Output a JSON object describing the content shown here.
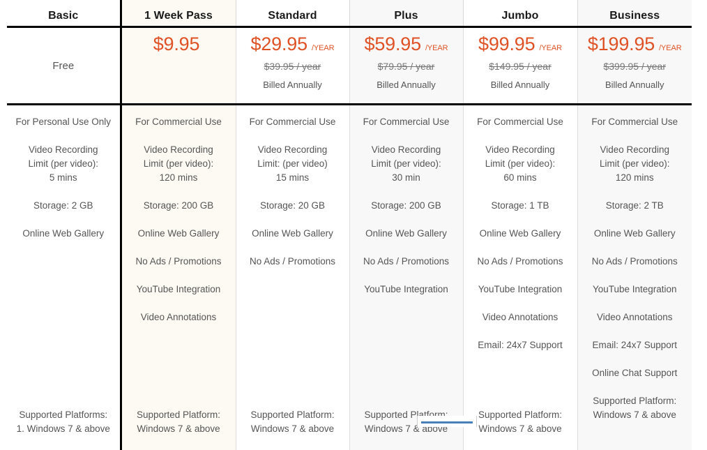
{
  "table": {
    "accent_color": "#df5226",
    "columns": [
      {
        "id": "basic",
        "name": "Basic",
        "tint": "none",
        "price": {
          "is_free": true,
          "free_label": "Free",
          "amount": "",
          "period": "",
          "old_price": "",
          "billed": ""
        },
        "features": [
          "For Personal Use Only",
          "Video Recording\nLimit (per video):\n5 mins",
          "Storage: 2 GB",
          "Online Web Gallery"
        ],
        "platform": "Supported Platforms:\n1. Windows 7 & above"
      },
      {
        "id": "week-pass",
        "name": "1 Week Pass",
        "tint": "cream",
        "price": {
          "is_free": false,
          "free_label": "",
          "amount": "$9.95",
          "period": "",
          "old_price": "",
          "billed": ""
        },
        "features": [
          "For Commercial Use",
          "Video Recording\nLimit (per video):\n120 mins",
          "Storage: 200 GB",
          "Online Web Gallery",
          "No Ads / Promotions",
          "YouTube Integration",
          "Video Annotations"
        ],
        "platform": "Supported Platform:\nWindows 7 & above"
      },
      {
        "id": "standard",
        "name": "Standard",
        "tint": "none",
        "price": {
          "is_free": false,
          "free_label": "",
          "amount": "$29.95",
          "period": "/YEAR",
          "old_price": "$39.95 / year",
          "billed": "Billed Annually"
        },
        "features": [
          "For Commercial Use",
          "Video Recording\nLimit: (per video)\n15 mins",
          "Storage: 20 GB",
          "Online Web Gallery",
          "No Ads / Promotions"
        ],
        "platform": "Supported Platform:\nWindows 7 & above"
      },
      {
        "id": "plus",
        "name": "Plus",
        "tint": "gray",
        "price": {
          "is_free": false,
          "free_label": "",
          "amount": "$59.95",
          "period": "/YEAR",
          "old_price": "$79.95 / year",
          "billed": "Billed Annually"
        },
        "features": [
          "For Commercial Use",
          "Video Recording\nLimit (per video):\n30 min",
          "Storage: 200 GB",
          "Online Web Gallery",
          "No Ads / Promotions",
          "YouTube Integration"
        ],
        "platform": "Supported Platform:\nWindows 7 & above"
      },
      {
        "id": "jumbo",
        "name": "Jumbo",
        "tint": "none",
        "price": {
          "is_free": false,
          "free_label": "",
          "amount": "$99.95",
          "period": "/YEAR",
          "old_price": "$149.95 / year",
          "billed": "Billed Annually"
        },
        "features": [
          "For Commercial Use",
          "Video Recording\nLimit (per video):\n60 mins",
          "Storage: 1 TB",
          "Online Web Gallery",
          "No Ads / Promotions",
          "YouTube Integration",
          "Video Annotations",
          "Email: 24x7 Support"
        ],
        "platform": "Supported Platform:\nWindows 7 & above"
      },
      {
        "id": "business",
        "name": "Business",
        "tint": "gray",
        "price": {
          "is_free": false,
          "free_label": "",
          "amount": "$199.95",
          "period": "/YEAR",
          "old_price": "$399.95 / year",
          "billed": "Billed Annually"
        },
        "features": [
          "For Commercial Use",
          "Video Recording\nLimit (per video):\n120 mins",
          "Storage: 2 TB",
          "Online Web Gallery",
          "No Ads / Promotions",
          "YouTube Integration",
          "Video Annotations",
          "Email: 24x7 Support",
          "Online Chat Support"
        ],
        "platform": "Supported Platform:\nWindows 7 & above"
      }
    ]
  },
  "overlay": {
    "popup_accent_color": "#4a7ebb"
  }
}
